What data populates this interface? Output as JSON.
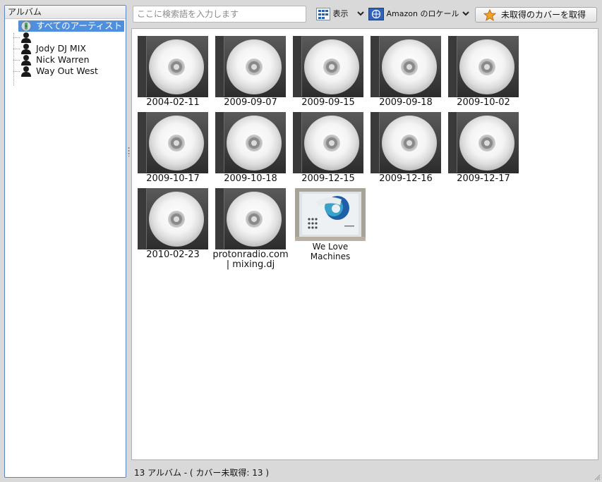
{
  "left_panel": {
    "header": "アルバム",
    "items": [
      {
        "label": "すべてのアーティスト",
        "icon": "all-artists-icon",
        "selected": true
      },
      {
        "label": "",
        "icon": "person-icon",
        "selected": false
      },
      {
        "label": "Jody DJ MIX",
        "icon": "person-icon",
        "selected": false
      },
      {
        "label": "Nick Warren",
        "icon": "person-icon",
        "selected": false
      },
      {
        "label": "Way Out West",
        "icon": "person-icon",
        "selected": false
      }
    ]
  },
  "toolbar": {
    "search_placeholder": "ここに検索語を入力します",
    "view_label": "表示",
    "locale_label": "Amazon のロケール",
    "fetch_button_label": "未取得のカバーを取得"
  },
  "albums": [
    {
      "title": "2004-02-11",
      "cover": "cd"
    },
    {
      "title": "2009-09-07",
      "cover": "cd"
    },
    {
      "title": "2009-09-15",
      "cover": "cd"
    },
    {
      "title": "2009-09-18",
      "cover": "cd"
    },
    {
      "title": "2009-10-02",
      "cover": "cd"
    },
    {
      "title": "2009-10-17",
      "cover": "cd"
    },
    {
      "title": "2009-10-18",
      "cover": "cd"
    },
    {
      "title": "2009-12-15",
      "cover": "cd"
    },
    {
      "title": "2009-12-16",
      "cover": "cd"
    },
    {
      "title": "2009-12-17",
      "cover": "cd"
    },
    {
      "title": "2010-02-23",
      "cover": "cd"
    },
    {
      "title": "protonradio.com | mixing.dj",
      "cover": "cd"
    },
    {
      "title": "We Love Machines",
      "cover": "photo"
    }
  ],
  "status_bar": {
    "text": "13 アルバム - ( カバー未取得: 13 )"
  },
  "colors": {
    "selection": "#4f8fdd",
    "panel_border": "#5a84c8",
    "window_bg": "#d9d9d9"
  }
}
